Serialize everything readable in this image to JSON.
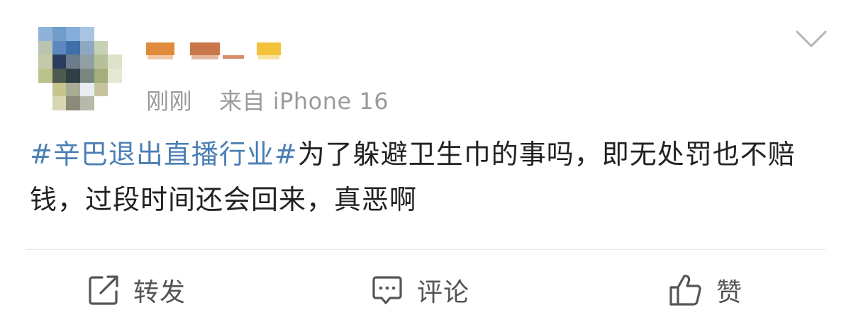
{
  "post": {
    "timestamp": "刚刚",
    "source": "来自 iPhone 16",
    "hashtag": "#辛巴退出直播行业#",
    "body": "为了躲避卫生巾的事吗，即无处罚也不赔钱，过段时间还会回来，真恶啊"
  },
  "actions": {
    "repost_label": "转发",
    "comment_label": "评论",
    "like_label": "赞"
  },
  "colors": {
    "hashtag": "#4a7fb5",
    "text": "#222222",
    "meta": "#9a9a9a",
    "icon": "#555555"
  },
  "icons": {
    "expand": "chevron-down-icon",
    "repost": "share-arrow-icon",
    "comment": "comment-bubble-icon",
    "like": "thumbs-up-icon"
  }
}
